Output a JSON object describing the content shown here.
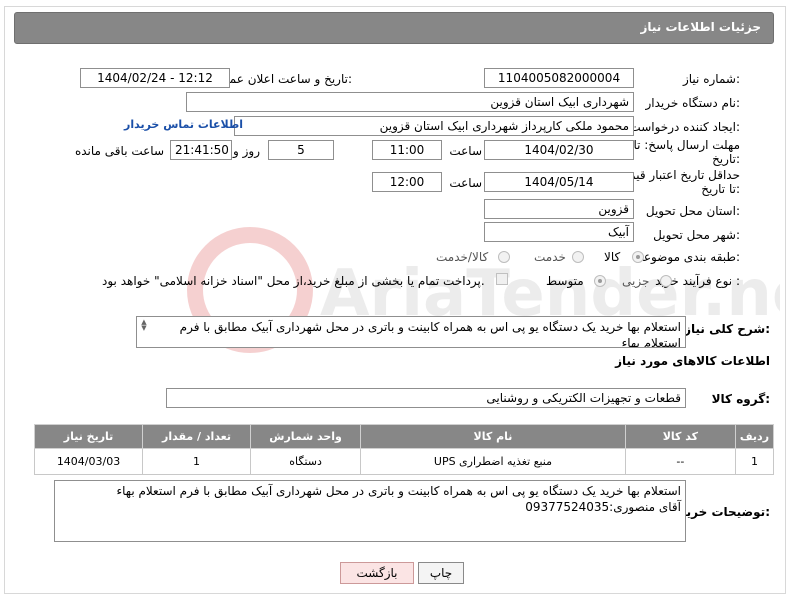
{
  "page_title": "جزئیات اطلاعات نیاز",
  "fields": {
    "need_number_label": "شماره نیاز:",
    "need_number": "1104005082000004",
    "announce_label": "تاریخ و ساعت اعلان عمومی:",
    "announce_value": "1404/02/24 - 12:12",
    "buyer_org_label": "نام دستگاه خریدار:",
    "buyer_org": "شهرداری ابیک استان قزوین",
    "creator_label": "ایجاد کننده درخواست:",
    "creator": "محمود ملکی کارپرداز شهرداری ابیک استان قزوین",
    "contact_link": "اطلاعات تماس خریدار",
    "reply_deadline_label": "مهلت ارسال پاسخ: تا تاریخ:",
    "reply_date": "1404/02/30",
    "time_label": "ساعت",
    "reply_time": "11:00",
    "days_value": "5",
    "days_label": "روز و",
    "remaining_time": "21:41:50",
    "remaining_label": "ساعت باقی مانده",
    "price_validity_label": "حداقل تاریخ اعتبار قیمت: تا تاریخ:",
    "validity_date": "1404/05/14",
    "validity_time": "12:00",
    "province_label": "استان محل تحویل:",
    "province": "قزوین",
    "city_label": "شهر محل تحویل:",
    "city": "آبیک",
    "category_label": "طبقه بندی موضوعی:",
    "category_options": [
      "کالا",
      "خدمت",
      "کالا/خدمت"
    ],
    "process_label": "نوع فرآیند خرید :",
    "process_options": [
      "جزیی",
      "متوسط"
    ],
    "payment_note": "پرداخت تمام یا بخشی از مبلغ خرید،از محل \"اسناد خزانه اسلامی\" خواهد بود.",
    "description_label": "شرح کلی نیاز:",
    "description": "استعلام بها خرید یک دستگاه یو پی اس به همراه کابینت و باتری در محل شهرداری آبیک مطابق با فرم استعلام بهاء",
    "goods_info_title": "اطلاعات کالاهای مورد نیاز",
    "goods_group_label": "گروه کالا:",
    "goods_group": "قطعات و تجهیزات الکتریکی و روشنایی",
    "buyer_notes_label": "توضیحات خریدار:",
    "buyer_notes_line1": "استعلام بها خرید یک دستگاه یو پی اس به همراه کابینت و باتری در محل شهرداری آبیک مطابق با فرم استعلام بهاء",
    "buyer_notes_line2": "آقای منصوری:09377524035"
  },
  "table": {
    "headers": [
      "ردیف",
      "کد کالا",
      "نام کالا",
      "واحد شمارش",
      "تعداد / مقدار",
      "تاریخ نیاز"
    ],
    "rows": [
      [
        "1",
        "--",
        "منبع تغذیه اضطراری UPS",
        "دستگاه",
        "1",
        "1404/03/03"
      ]
    ]
  },
  "buttons": {
    "print": "چاپ",
    "back": "بازگشت"
  },
  "watermark_text": "AriaTender.neT",
  "colors": {
    "header_bg": "#878787",
    "link": "#1a4fa8",
    "back_button_bg": "#fbe4e4"
  }
}
